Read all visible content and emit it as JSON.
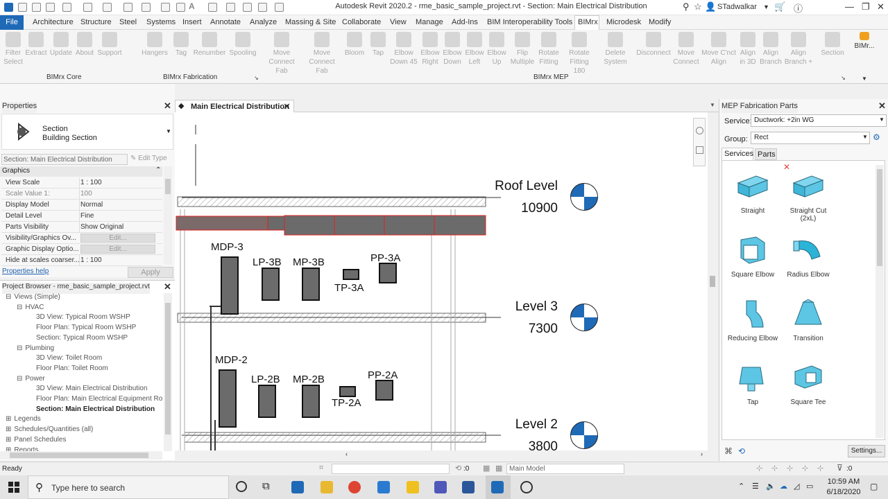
{
  "app": {
    "title": "Autodesk Revit 2020.2 - rme_basic_sample_project.rvt - Section: Main Electrical Distribution",
    "user": "STadwalkar"
  },
  "menu": [
    "File",
    "Architecture",
    "Structure",
    "Steel",
    "Systems",
    "Insert",
    "Annotate",
    "Analyze",
    "Massing & Site",
    "Collaborate",
    "View",
    "Manage",
    "Add-Ins",
    "BIM Interoperability Tools",
    "BIMrx",
    "Microdesk",
    "Modify"
  ],
  "ribbon": {
    "core": [
      "Filter Select",
      "Extract",
      "Update",
      "About",
      "Support"
    ],
    "fab": [
      "Hangers",
      "Tag",
      "Renumber",
      "Spooling"
    ],
    "mep": [
      "Move Connect Fab",
      "Move Connect Fab",
      "Bloom",
      "Tap",
      "Elbow Down 45",
      "Elbow Right",
      "Elbow Down",
      "Elbow Left",
      "Elbow Up",
      "Flip Multiple",
      "Rotate Fitting",
      "Rotate Fitting 180",
      "Delete System",
      "Disconnect",
      "Move Connect",
      "Move C'nct Align",
      "Align in 3D",
      "Align Branch",
      "Align Branch +",
      "Section"
    ],
    "more": "BIMr...",
    "groups": {
      "core": "BIMrx Core",
      "fab": "BIMrx Fabrication",
      "mep": "BIMrx MEP"
    }
  },
  "properties": {
    "title": "Properties",
    "type_name": "Section",
    "type_sub": "Building Section",
    "instance": "Section: Main Electrical Distribution",
    "edit_type": "Edit Type",
    "category": "Graphics",
    "rows": [
      {
        "k": "View Scale",
        "v": "1 : 100"
      },
      {
        "k": "Scale Value    1:",
        "v": "100"
      },
      {
        "k": "Display Model",
        "v": "Normal"
      },
      {
        "k": "Detail Level",
        "v": "Fine"
      },
      {
        "k": "Parts Visibility",
        "v": "Show Original"
      },
      {
        "k": "Visibility/Graphics Ov...",
        "v": "Edit..."
      },
      {
        "k": "Graphic Display Optio...",
        "v": "Edit..."
      },
      {
        "k": "Hide at scales coarser...",
        "v": "1 : 100"
      }
    ],
    "help": "Properties help",
    "apply": "Apply"
  },
  "browser": {
    "title": "Project Browser - rme_basic_sample_project.rvt",
    "items": [
      {
        "t": "Views (Simple)",
        "d": 0,
        "exp": "-"
      },
      {
        "t": "HVAC",
        "d": 1,
        "exp": "-"
      },
      {
        "t": "3D View: Typical Room WSHP",
        "d": 2
      },
      {
        "t": "Floor Plan: Typical Room WSHP",
        "d": 2
      },
      {
        "t": "Section: Typical Room WSHP",
        "d": 2
      },
      {
        "t": "Plumbing",
        "d": 1,
        "exp": "-"
      },
      {
        "t": "3D View: Toilet Room",
        "d": 2
      },
      {
        "t": "Floor Plan: Toilet Room",
        "d": 2
      },
      {
        "t": "Power",
        "d": 1,
        "exp": "-"
      },
      {
        "t": "3D View: Main Electrical Distribution",
        "d": 2
      },
      {
        "t": "Floor Plan: Main Electrical Equipment Ro",
        "d": 2
      },
      {
        "t": "Section: Main Electrical Distribution",
        "d": 2,
        "bold": true
      },
      {
        "t": "Legends",
        "d": 0,
        "exp": "+"
      },
      {
        "t": "Schedules/Quantities (all)",
        "d": 0,
        "exp": "+"
      },
      {
        "t": "Panel Schedules",
        "d": 0,
        "exp": "+"
      },
      {
        "t": "Reports",
        "d": 0,
        "exp": "+"
      }
    ]
  },
  "view": {
    "tab": "Main Electrical Distribution",
    "levels": [
      {
        "name": "Roof Level",
        "elev": "10900"
      },
      {
        "name": "Level 3",
        "elev": "7300"
      },
      {
        "name": "Level 2",
        "elev": "3800"
      }
    ],
    "equipment": [
      "MDP-3",
      "LP-3B",
      "MP-3B",
      "TP-3A",
      "PP-3A",
      "MDP-2",
      "LP-2B",
      "MP-2B",
      "TP-2A",
      "PP-2A"
    ]
  },
  "fab": {
    "title": "MEP Fabrication Parts",
    "service_label": "Service:",
    "service": "Ductwork: +2in WG",
    "group_label": "Group:",
    "group": "Rect",
    "tabs": [
      "Services",
      "Parts"
    ],
    "parts": [
      "Straight",
      "Straight Cut (2xL)",
      "Square Elbow",
      "Radius Elbow",
      "Reducing Elbow",
      "Transition",
      "Tap",
      "Square Tee"
    ],
    "settings": "Settings..."
  },
  "status": {
    "text": "Ready",
    "zero": ":0",
    "model": "Main Model",
    "filter": ":0"
  },
  "taskbar": {
    "search": "Type here to search",
    "time": "10:59 AM",
    "date": "6/18/2020"
  }
}
